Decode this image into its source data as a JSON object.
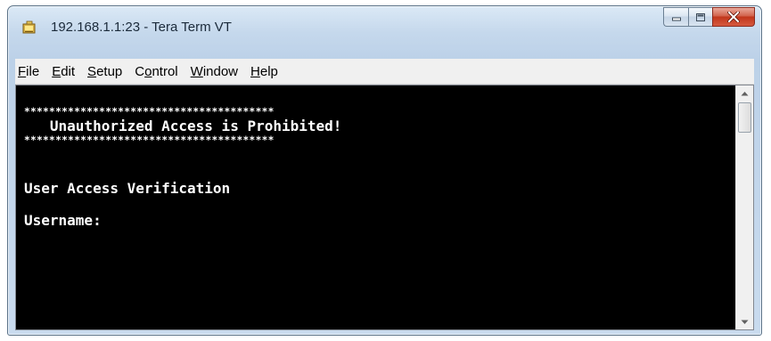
{
  "window": {
    "title": "192.168.1.1:23 - Tera Term VT",
    "icon": "tera-term-icon"
  },
  "caption_buttons": {
    "minimize": "minimize-icon",
    "maximize": "maximize-icon",
    "close": "close-icon",
    "close_color": "#c1361b"
  },
  "menu": {
    "items": [
      {
        "ul": "F",
        "rest": "ile",
        "pre": ""
      },
      {
        "ul": "E",
        "rest": "dit",
        "pre": ""
      },
      {
        "ul": "S",
        "rest": "etup",
        "pre": ""
      },
      {
        "pre": "C",
        "ul": "o",
        "rest": "ntrol"
      },
      {
        "ul": "W",
        "rest": "indow",
        "pre": ""
      },
      {
        "ul": "H",
        "rest": "elp",
        "pre": ""
      }
    ]
  },
  "terminal": {
    "background": "#000000",
    "foreground": "#ffffff",
    "border_line_top": "****************************************",
    "banner": "   Unauthorized Access is Prohibited!",
    "border_line_bottom": "****************************************",
    "heading": "User Access Verification",
    "prompt": "Username:"
  }
}
